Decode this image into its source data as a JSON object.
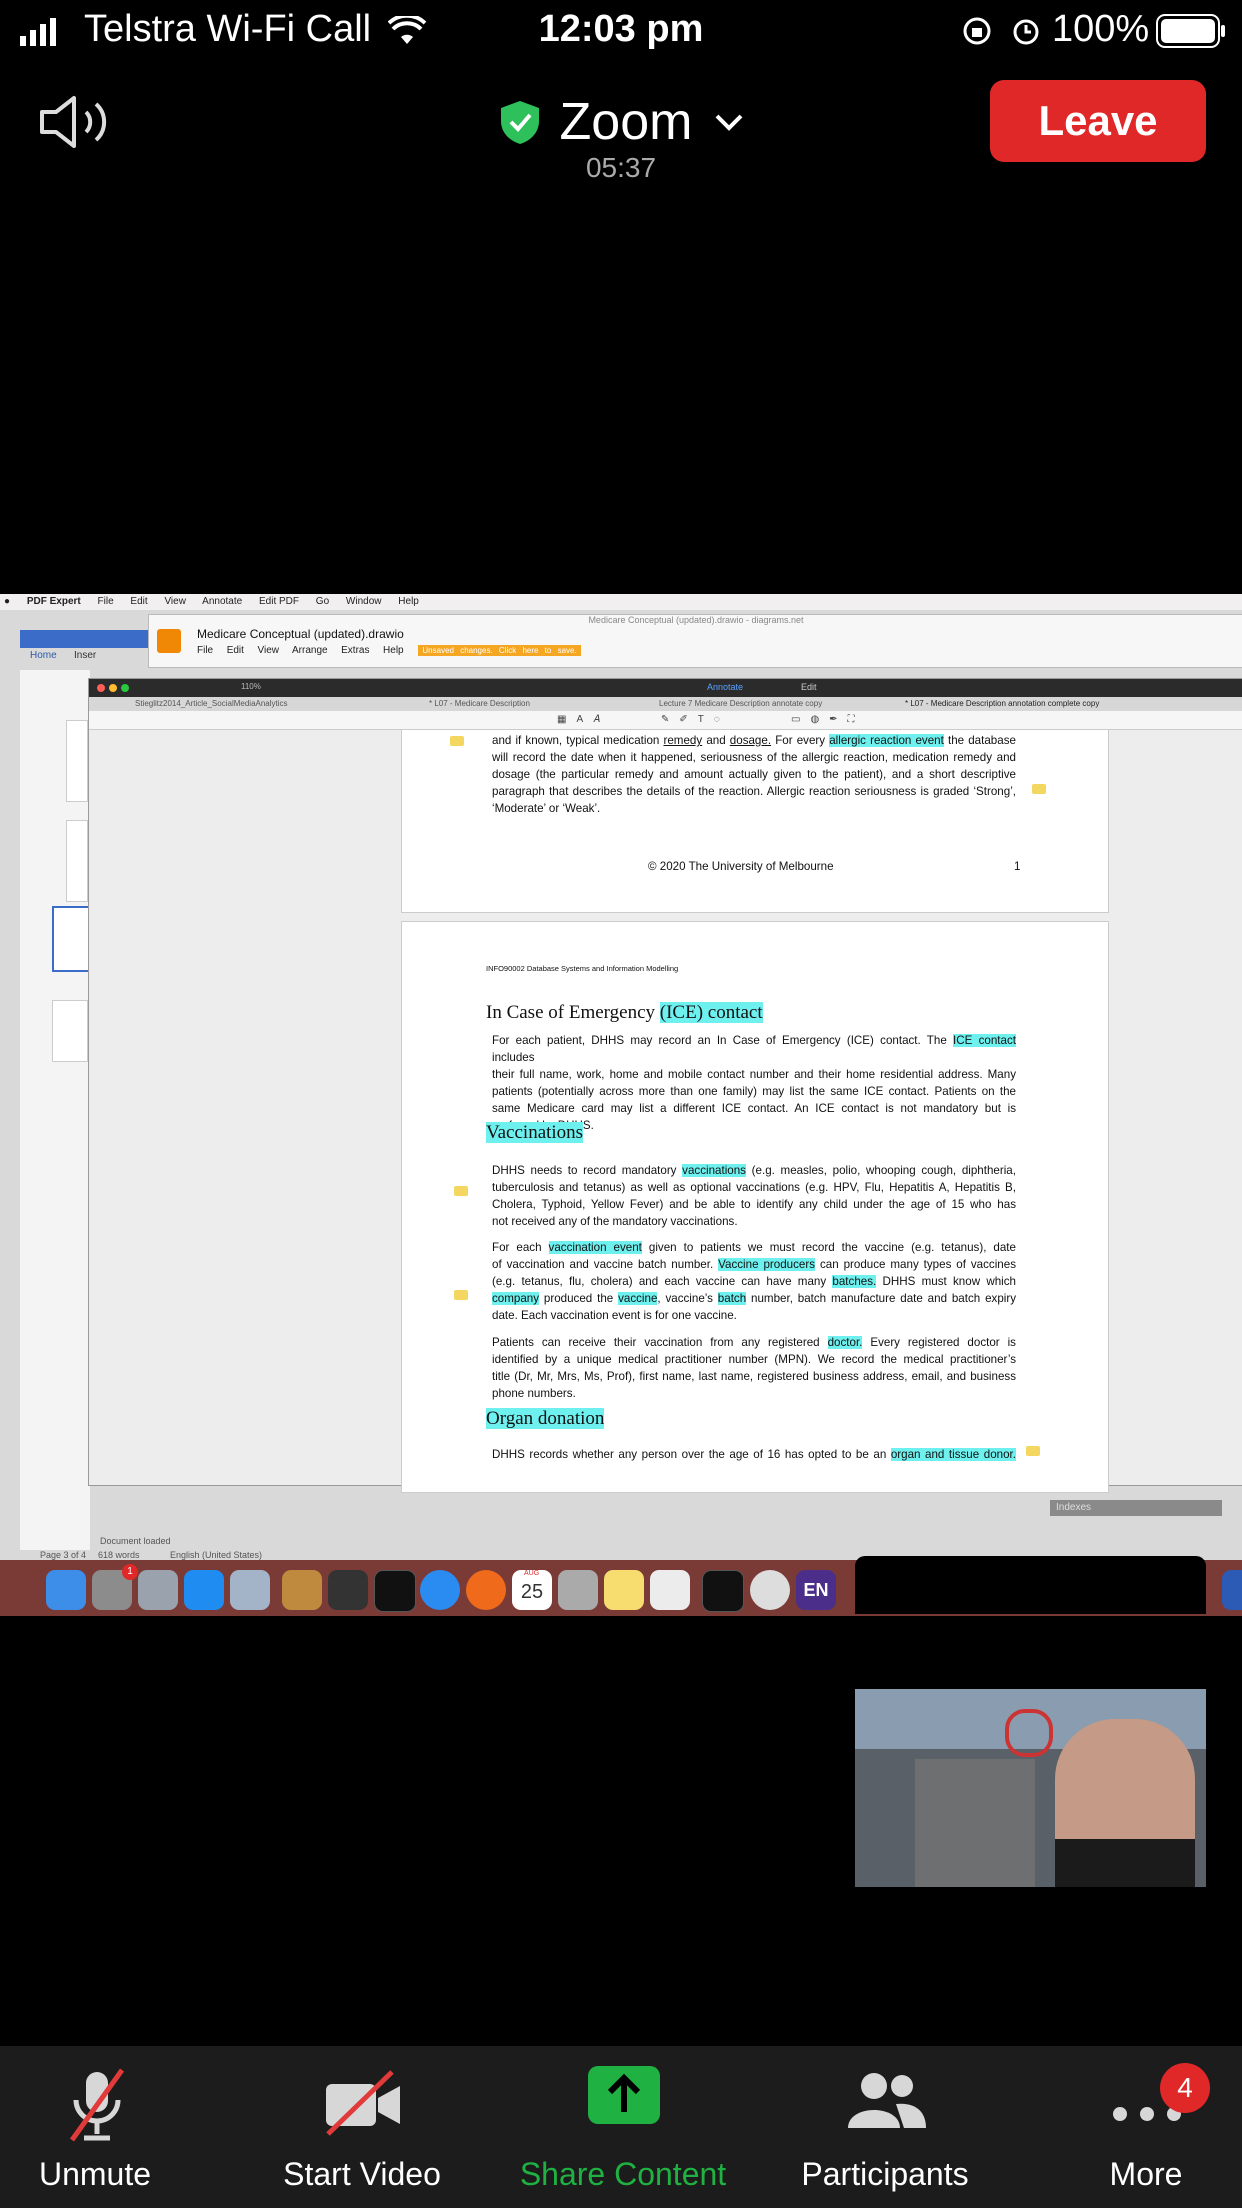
{
  "status_bar": {
    "carrier": "Telstra Wi-Fi Call",
    "time": "12:03 pm",
    "battery": "100%"
  },
  "header": {
    "title": "Zoom",
    "timer": "05:37",
    "leave_label": "Leave"
  },
  "shared_screen": {
    "menubar": [
      "PDF Expert",
      "File",
      "Edit",
      "View",
      "Annotate",
      "Edit PDF",
      "Go",
      "Window",
      "Help"
    ],
    "drawio_title": "Medicare Conceptual (updated).drawio",
    "drawio_window_title": "Medicare Conceptual (updated).drawio - diagrams.net",
    "drawio_menu": [
      "File",
      "Edit",
      "View",
      "Arrange",
      "Extras",
      "Help"
    ],
    "unsaved_banner": "Unsaved changes. Click here to save.",
    "pdf_tabs": [
      "Stieglitz2014_Article_SocialMediaAnalytics",
      "* L07 - Medicare Description",
      "Lecture 7 Medicare Description annotate copy",
      "* L07 - Medicare Description annotation complete copy"
    ],
    "pdf_toolbar": {
      "annotate": "Annotate",
      "edit": "Edit",
      "zoom": "110%"
    },
    "word_tabs": {
      "home": "Home",
      "insert": "Inser"
    },
    "word_status": {
      "page": "Page 3 of 4",
      "words": "618 words",
      "lang": "English (United States)",
      "doc_loaded": "Document loaded"
    },
    "indexes_label": "Indexes",
    "page1": {
      "line1_a": "and if known, typical medication",
      "line1_remedy": "remedy",
      "line1_b": "and",
      "line1_dosage": "dosage.",
      "line1_c": "For every",
      "line1_hl": "allergic reaction event",
      "line1_d": "the database",
      "line2": "will record the date when it happened, seriousness of the allergic reaction, medication remedy and",
      "line3": "dosage (the particular remedy and amount actually given to the patient), and a short descriptive",
      "line4": "paragraph that describes the details of the reaction. Allergic reaction seriousness is graded ‘Strong’,",
      "line5": "‘Moderate’ or ‘Weak’.",
      "footer": "© 2020 The University of Melbourne",
      "page_number": "1"
    },
    "page2": {
      "running_head": "INFO90002 Database Systems and Information Modelling",
      "ice_heading_plain": "In Case of Emergency ",
      "ice_heading_hl": "(ICE) contact",
      "ice_p1_a": "For each patient, DHHS may record an In Case of Emergency (ICE) contact. The",
      "ice_p1_hl": "ICE contact",
      "ice_p1_b": "includes",
      "ice_p2": "their full name, work, home and mobile contact number and their home residential address. Many",
      "ice_p3": "patients (potentially across more than one family) may list the same ICE contact. Patients on the",
      "ice_p4": "same Medicare card may list a different ICE contact. An ICE contact is not mandatory but is",
      "ice_p5": "preferred by DHHS.",
      "vacc_heading": "Vaccinations",
      "vacc_p1_a": "DHHS needs to record mandatory",
      "vacc_p1_hl": "vaccinations",
      "vacc_p1_b": "(e.g. measles, polio, whooping cough, diphtheria,",
      "vacc_p2": "tuberculosis and tetanus) as well as optional vaccinations (e.g. HPV, Flu, Hepatitis A, Hepatitis B,",
      "vacc_p3": "Cholera, Typhoid, Yellow Fever) and be able to identify any child under the age of 15 who has",
      "vacc_p4": "not received any of the mandatory vaccinations.",
      "ve_p1_a": "For each",
      "ve_p1_hl": "vaccination event",
      "ve_p1_b": "given to patients we must record the vaccine (e.g. tetanus), date",
      "ve_p2_a": "of vaccination and vaccine batch number.",
      "ve_p2_hl": "Vaccine producers",
      "ve_p2_b": "can produce many types of vaccines",
      "ve_p3_a": "(e.g. tetanus, flu, cholera) and each vaccine can have many",
      "ve_p3_hl": "batches.",
      "ve_p3_b": "DHHS must know which",
      "ve_p4_hl1": "company",
      "ve_p4_a": "produced the",
      "ve_p4_hl2": "vaccine",
      "ve_p4_b": ", vaccine’s",
      "ve_p4_hl3": "batch",
      "ve_p4_c": "number, batch manufacture date and batch expiry",
      "ve_p5": "date. Each vaccination event is for one vaccine.",
      "doc_p1_a": "Patients can receive their vaccination from any registered",
      "doc_p1_hl": "doctor.",
      "doc_p1_b": "Every registered doctor is",
      "doc_p2": "identified by a unique medical practitioner number (MPN). We record the medical practitioner’s",
      "doc_p3": "title (Dr, Mr, Mrs, Ms, Prof), first name, last name, registered business address, email, and business",
      "doc_p4": "phone numbers.",
      "organ_heading": "Organ donation",
      "organ_p1_a": "DHHS records whether any person over the age of 16 has opted to be an",
      "organ_p1_hl": "organ and tissue donor."
    },
    "dock_date": "25",
    "dock_month": "AUG",
    "dock_en": "EN",
    "dock_badge": "1"
  },
  "toolbar": {
    "unmute": "Unmute",
    "start_video": "Start Video",
    "share_content": "Share Content",
    "participants": "Participants",
    "more": "More",
    "more_badge": "4"
  },
  "colors": {
    "leave": "#e02828",
    "share_green": "#1fb141",
    "highlight": "#6ef0ef",
    "shield_green": "#2ec05a"
  }
}
